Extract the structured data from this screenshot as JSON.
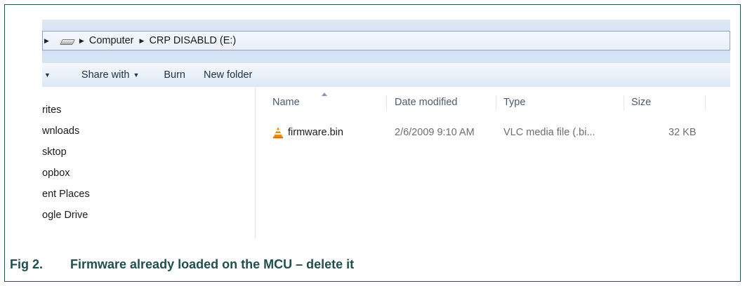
{
  "address_bar": {
    "crumbs": [
      "Computer",
      "CRP DISABLD (E:)"
    ]
  },
  "toolbar": {
    "share_with": "Share with",
    "burn": "Burn",
    "new_folder": "New folder"
  },
  "nav_pane": {
    "items": [
      "rites",
      "wnloads",
      "sktop",
      "opbox",
      "ent Places",
      "ogle Drive"
    ]
  },
  "file_list": {
    "columns": [
      "Name",
      "Date modified",
      "Type",
      "Size"
    ],
    "rows": [
      {
        "name": "firmware.bin",
        "date_modified": "2/6/2009 9:10 AM",
        "type": "VLC media file (.bi...",
        "size": "32 KB",
        "icon": "vlc-cone-icon"
      }
    ]
  },
  "caption": {
    "figure": "Fig 2.",
    "text": "Firmware already loaded on the MCU – delete it"
  },
  "colors": {
    "caption": "#1f4f4f",
    "toolbar_bg": "#e8f0f9",
    "accent_orange": "#f08a00"
  }
}
